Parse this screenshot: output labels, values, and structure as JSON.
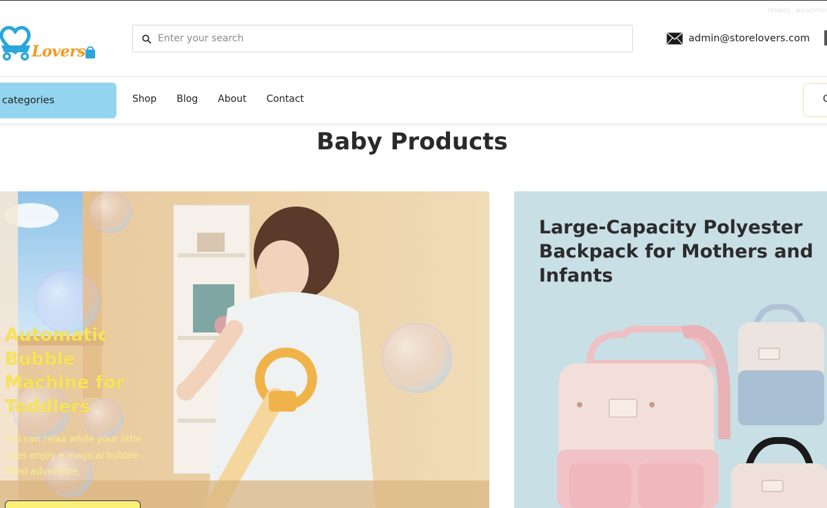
{
  "topbar": {
    "howdy_text": "Howdy, wpadmin"
  },
  "logo": {
    "text": "Lovers",
    "icon": "heart-stroller-logo",
    "colors": {
      "blue": "#2aa7d8",
      "orange": "#f39a1f"
    }
  },
  "search": {
    "placeholder": "Enter your search",
    "value": "",
    "icon": "search-icon"
  },
  "contact": {
    "email": "admin@storelovers.com",
    "icon": "mail-icon"
  },
  "nav": {
    "categories_label": "categories",
    "links": [
      "Shop",
      "Blog",
      "About",
      "Contact"
    ],
    "right_button_label": "C"
  },
  "section": {
    "title": "Baby Products"
  },
  "cards": [
    {
      "title": "Automatic Bubble Machine for Toddlers",
      "description": "You can relax while your little ones enjoy a magical bubble-filled adventure."
    },
    {
      "title": "Large-Capacity Polyester Backpack for Mothers and Infants"
    }
  ],
  "colors": {
    "categories_bg": "#93d5ef",
    "card2_bg": "#c9dfe6",
    "card1_title": "#f7e35a",
    "accent_yellow": "#fbf07a"
  }
}
